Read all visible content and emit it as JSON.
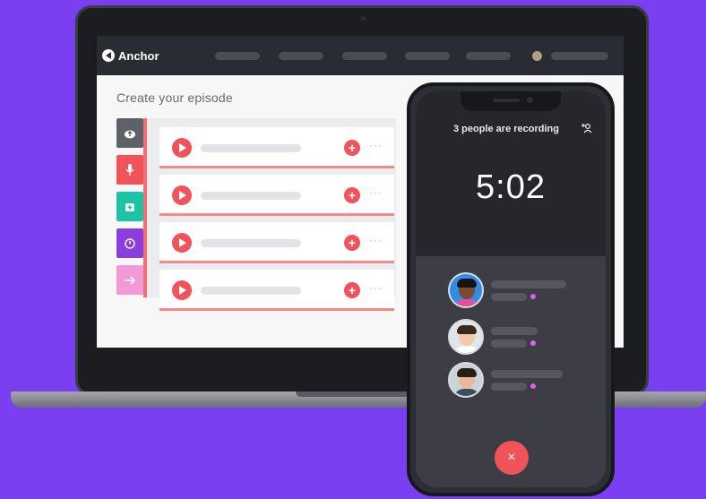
{
  "laptop": {
    "app": {
      "logo_text": "Anchor",
      "page_title": "Create your episode"
    },
    "tools": [
      {
        "icon": "cloud-upload-icon",
        "color": "#5f6168"
      },
      {
        "icon": "microphone-icon",
        "color": "#f0535a"
      },
      {
        "icon": "library-icon",
        "color": "#1dc3a5"
      },
      {
        "icon": "clock-icon",
        "color": "#8a3ee0"
      },
      {
        "icon": "arrow-right-icon",
        "color": "#f29ad8"
      }
    ],
    "tracks": [
      {
        "add_label": "+",
        "more_label": "···"
      },
      {
        "add_label": "+",
        "more_label": "···"
      },
      {
        "add_label": "+",
        "more_label": "···"
      },
      {
        "add_label": "+",
        "more_label": "···"
      }
    ]
  },
  "phone": {
    "recording_status": "3 people are recording",
    "timer": "5:02",
    "end_label": "×",
    "participants": [
      {
        "avatar_bg": "#2c8ee8",
        "skin": "#7a4a2c",
        "hair": "#1a1210",
        "shirt": "#e64fa1"
      },
      {
        "avatar_bg": "#dfe6ea",
        "skin": "#f0c9a8",
        "hair": "#3a2a1e",
        "shirt": "#ffffff"
      },
      {
        "avatar_bg": "#c9d3d8",
        "skin": "#e8b999",
        "hair": "#2a1c16",
        "shirt": "#3a4f5a"
      }
    ]
  },
  "colors": {
    "background": "#7b3ff2",
    "accent": "#f0535a",
    "live_dot": "#e05cf2"
  }
}
